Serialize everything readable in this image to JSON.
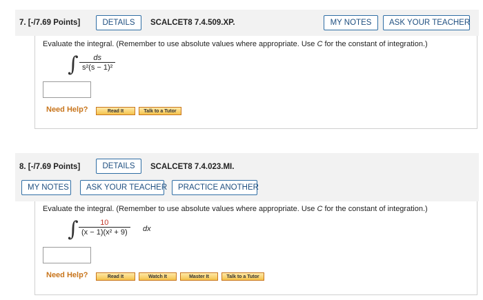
{
  "q7": {
    "number": "7.",
    "points": "[-/7.69 Points]",
    "details_label": "DETAILS",
    "code": "SCALCET8 7.4.509.XP.",
    "my_notes_label": "MY NOTES",
    "ask_teacher_label": "ASK YOUR TEACHER",
    "instruction_pre": "Evaluate the integral. (Remember to use absolute values where appropriate. Use ",
    "instruction_var": "C",
    "instruction_post": " for the constant of integration.)",
    "integral_symbol": "∫",
    "numerator": "ds",
    "denominator": "s²(s − 1)²",
    "need_help_label": "Need Help?",
    "help_buttons": [
      "Read It",
      "Talk to a Tutor"
    ]
  },
  "q8": {
    "number": "8.",
    "points": "[-/7.69 Points]",
    "details_label": "DETAILS",
    "code": "SCALCET8 7.4.023.MI.",
    "my_notes_label": "MY NOTES",
    "ask_teacher_label": "ASK YOUR TEACHER",
    "practice_label": "PRACTICE ANOTHER",
    "instruction_pre": "Evaluate the integral. (Remember to use absolute values where appropriate. Use ",
    "instruction_var": "C",
    "instruction_post": " for the constant of integration.)",
    "integral_symbol": "∫",
    "numerator": "10",
    "denominator": "(x − 1)(x² + 9)",
    "dx": "dx",
    "need_help_label": "Need Help?",
    "help_buttons": [
      "Read It",
      "Watch It",
      "Master It",
      "Talk to a Tutor"
    ]
  }
}
